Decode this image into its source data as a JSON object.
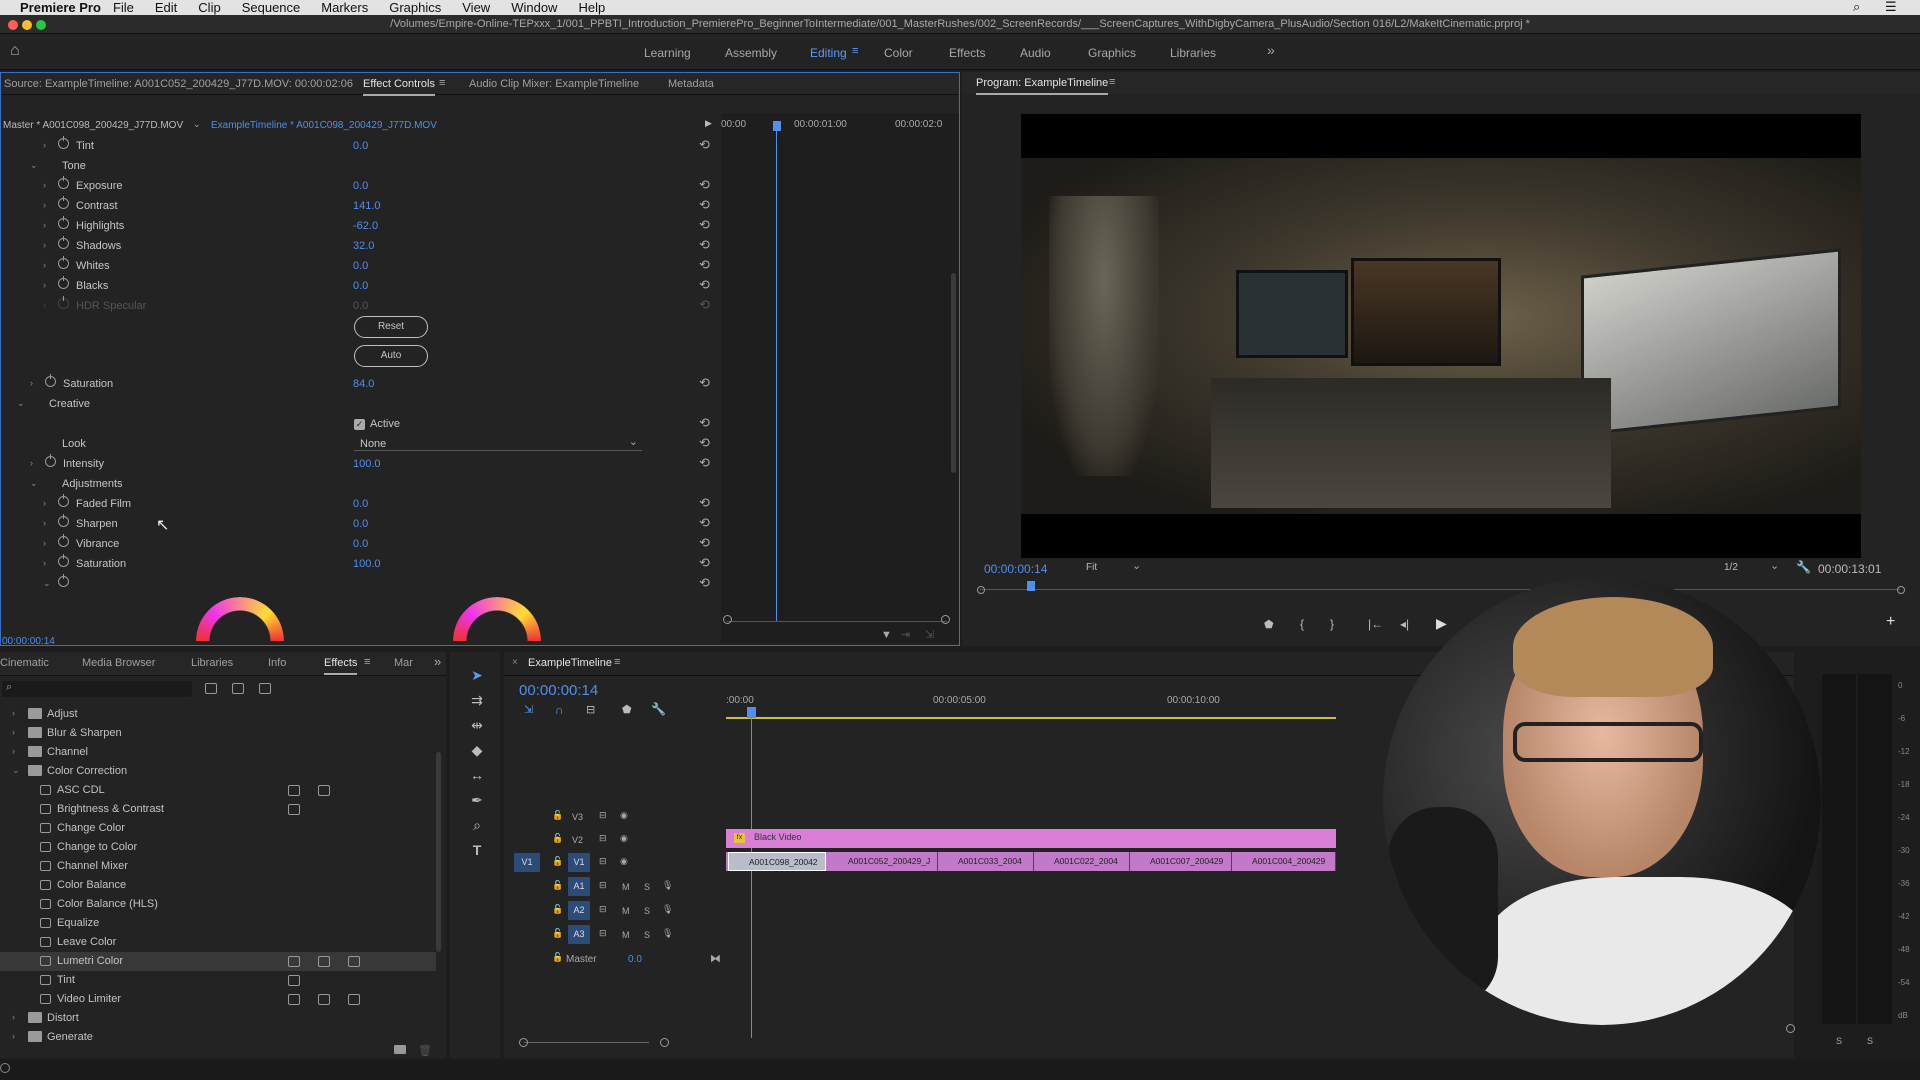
{
  "menubar": {
    "app": "Premiere Pro",
    "items": [
      "File",
      "Edit",
      "Clip",
      "Sequence",
      "Markers",
      "Graphics",
      "View",
      "Window",
      "Help"
    ]
  },
  "window": {
    "title": "/Volumes/Empire-Online-TEPxxx_1/001_PPBTI_Introduction_PremierePro_BeginnerToIntermediate/001_MasterRushes/002_ScreenRecords/___ScreenCaptures_WithDigbyCamera_PlusAudio/Section 016/L2/MakeItCinematic.prproj *"
  },
  "workspaces": [
    "Learning",
    "Assembly",
    "Editing",
    "Color",
    "Effects",
    "Audio",
    "Graphics",
    "Libraries"
  ],
  "workspace_more": "»",
  "effect_controls": {
    "tabs": {
      "source": "Source: ExampleTimeline: A001C052_200429_J77D.MOV: 00:00:02:06",
      "effect_controls": "Effect Controls",
      "audio_mixer": "Audio Clip Mixer: ExampleTimeline",
      "metadata": "Metadata"
    },
    "master_clip": "Master * A001C098_200429_J77D.MOV",
    "seq_clip": "ExampleTimeline * A001C098_200429_J77D.MOV",
    "ruler": [
      "00:00",
      "00:00:01:00",
      "00:00:02:0"
    ],
    "rows": [
      {
        "label": "Tint",
        "value": "0.0"
      },
      {
        "label": "Tone",
        "value": ""
      },
      {
        "label": "Exposure",
        "value": "0.0"
      },
      {
        "label": "Contrast",
        "value": "141.0"
      },
      {
        "label": "Highlights",
        "value": "-62.0"
      },
      {
        "label": "Shadows",
        "value": "32.0"
      },
      {
        "label": "Whites",
        "value": "0.0"
      },
      {
        "label": "Blacks",
        "value": "0.0"
      },
      {
        "label": "HDR Specular",
        "value": "0.0"
      }
    ],
    "reset_label": "Reset",
    "auto_label": "Auto",
    "saturation": {
      "label": "Saturation",
      "value": "84.0"
    },
    "creative": "Creative",
    "active_label": "Active",
    "look": {
      "label": "Look",
      "value": "None"
    },
    "intensity": {
      "label": "Intensity",
      "value": "100.0"
    },
    "adjustments": "Adjustments",
    "adj_rows": [
      {
        "label": "Faded Film",
        "value": "0.0"
      },
      {
        "label": "Sharpen",
        "value": "0.0"
      },
      {
        "label": "Vibrance",
        "value": "0.0"
      },
      {
        "label": "Saturation",
        "value": "100.0"
      }
    ],
    "timecode": "00:00:00:14"
  },
  "program": {
    "title": "Program: ExampleTimeline",
    "timecode": "00:00:00:14",
    "fit": "Fit",
    "resolution": "1/2",
    "duration": "00:00:13:01"
  },
  "effects_panel": {
    "tabs": [
      "Cinematic",
      "Media Browser",
      "Libraries",
      "Info",
      "Effects",
      "Mar"
    ],
    "folders_top": [
      "Adjust",
      "Blur & Sharpen",
      "Channel",
      "Color Correction"
    ],
    "items": [
      "ASC CDL",
      "Brightness & Contrast",
      "Change Color",
      "Change to Color",
      "Channel Mixer",
      "Color Balance",
      "Color Balance (HLS)",
      "Equalize",
      "Leave Color",
      "Lumetri Color",
      "Tint",
      "Video Limiter"
    ],
    "folders_bottom": [
      "Distort",
      "Generate"
    ]
  },
  "timeline": {
    "title": "ExampleTimeline",
    "timecode": "00:00:00:14",
    "ruler": [
      ":00:00",
      "00:00:05:00",
      "00:00:10:00"
    ],
    "tracks": [
      "V3",
      "V2",
      "V1",
      "A1",
      "A2",
      "A3"
    ],
    "master_label": "Master",
    "master_value": "0.0",
    "track_v1_src": "V1",
    "black_video": "Black Video",
    "clips": [
      "A001C098_20042",
      "A001C052_200429_J",
      "A001C033_2004",
      "A001C022_2004",
      "A001C007_200429",
      "A001C004_200429"
    ]
  },
  "audio_meter": {
    "ticks": [
      "0",
      "-6",
      "-12",
      "-18",
      "-24",
      "-30",
      "-36",
      "-42",
      "-48",
      "-54",
      "dB"
    ],
    "solo": [
      "S",
      "S"
    ]
  }
}
